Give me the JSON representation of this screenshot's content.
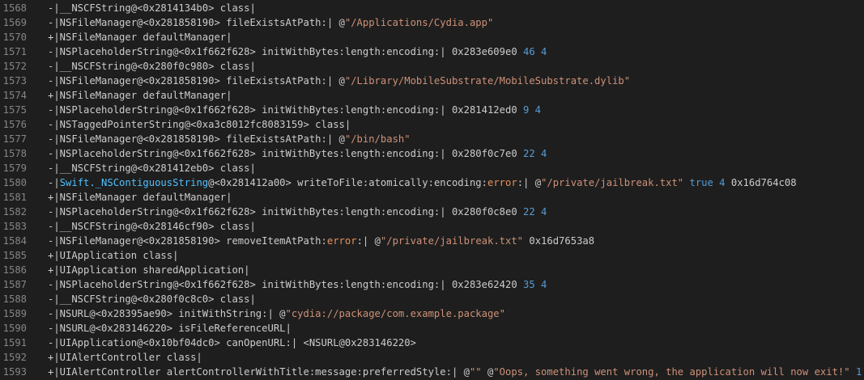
{
  "colors": {
    "background": "#1e1e1e",
    "line_number": "#858585",
    "text": "#cccccc",
    "string": "#ce9178",
    "number": "#569cd6",
    "keyword": "#4fc1ff",
    "error_keyword": "#e8925b"
  },
  "lines": [
    {
      "num": "1568",
      "tokens": [
        {
          "t": "-|__NSCFString@<0x2814134b0> class|",
          "k": "plain"
        }
      ]
    },
    {
      "num": "1569",
      "tokens": [
        {
          "t": "-|NSFileManager@<0x281858190> fileExistsAtPath:| @",
          "k": "plain"
        },
        {
          "t": "\"/Applications/Cydia.app\"",
          "k": "str"
        }
      ]
    },
    {
      "num": "1570",
      "tokens": [
        {
          "t": "+|NSFileManager defaultManager|",
          "k": "plain"
        }
      ]
    },
    {
      "num": "1571",
      "tokens": [
        {
          "t": "-|NSPlaceholderString@<0x1f662f628> initWithBytes:length:encoding:| 0x283e609e0 ",
          "k": "plain"
        },
        {
          "t": "46 4",
          "k": "num"
        }
      ]
    },
    {
      "num": "1572",
      "tokens": [
        {
          "t": "-|__NSCFString@<0x280f0c980> class|",
          "k": "plain"
        }
      ]
    },
    {
      "num": "1573",
      "tokens": [
        {
          "t": "-|NSFileManager@<0x281858190> fileExistsAtPath:| @",
          "k": "plain"
        },
        {
          "t": "\"/Library/MobileSubstrate/MobileSubstrate.dylib\"",
          "k": "str"
        }
      ]
    },
    {
      "num": "1574",
      "tokens": [
        {
          "t": "+|NSFileManager defaultManager|",
          "k": "plain"
        }
      ]
    },
    {
      "num": "1575",
      "tokens": [
        {
          "t": "-|NSPlaceholderString@<0x1f662f628> initWithBytes:length:encoding:| 0x281412ed0 ",
          "k": "plain"
        },
        {
          "t": "9 4",
          "k": "num"
        }
      ]
    },
    {
      "num": "1576",
      "tokens": [
        {
          "t": "-|NSTaggedPointerString@<0xa3c8012fc8083159> class|",
          "k": "plain"
        }
      ]
    },
    {
      "num": "1577",
      "tokens": [
        {
          "t": "-|NSFileManager@<0x281858190> fileExistsAtPath:| @",
          "k": "plain"
        },
        {
          "t": "\"/bin/bash\"",
          "k": "str"
        }
      ]
    },
    {
      "num": "1578",
      "tokens": [
        {
          "t": "-|NSPlaceholderString@<0x1f662f628> initWithBytes:length:encoding:| 0x280f0c7e0 ",
          "k": "plain"
        },
        {
          "t": "22 4",
          "k": "num"
        }
      ]
    },
    {
      "num": "1579",
      "tokens": [
        {
          "t": "-|__NSCFString@<0x281412eb0> class|",
          "k": "plain"
        }
      ]
    },
    {
      "num": "1580",
      "tokens": [
        {
          "t": "-|",
          "k": "plain"
        },
        {
          "t": "Swift._NSContiguousString",
          "k": "kw"
        },
        {
          "t": "@<0x281412a00> writeToFile:atomically:encoding:",
          "k": "plain"
        },
        {
          "t": "error",
          "k": "err"
        },
        {
          "t": ":| @",
          "k": "plain"
        },
        {
          "t": "\"/private/jailbreak.txt\"",
          "k": "str"
        },
        {
          "t": " ",
          "k": "plain"
        },
        {
          "t": "true 4",
          "k": "num"
        },
        {
          "t": " 0x16d764c08",
          "k": "plain"
        }
      ]
    },
    {
      "num": "1581",
      "tokens": [
        {
          "t": "+|NSFileManager defaultManager|",
          "k": "plain"
        }
      ]
    },
    {
      "num": "1582",
      "tokens": [
        {
          "t": "-|NSPlaceholderString@<0x1f662f628> initWithBytes:length:encoding:| 0x280f0c8e0 ",
          "k": "plain"
        },
        {
          "t": "22 4",
          "k": "num"
        }
      ]
    },
    {
      "num": "1583",
      "tokens": [
        {
          "t": "-|__NSCFString@<0x28146cf90> class|",
          "k": "plain"
        }
      ]
    },
    {
      "num": "1584",
      "tokens": [
        {
          "t": "-|NSFileManager@<0x281858190> removeItemAtPath:",
          "k": "plain"
        },
        {
          "t": "error",
          "k": "err"
        },
        {
          "t": ":| @",
          "k": "plain"
        },
        {
          "t": "\"/private/jailbreak.txt\"",
          "k": "str"
        },
        {
          "t": " 0x16d7653a8",
          "k": "plain"
        }
      ]
    },
    {
      "num": "1585",
      "tokens": [
        {
          "t": "+|UIApplication class|",
          "k": "plain"
        }
      ]
    },
    {
      "num": "1586",
      "tokens": [
        {
          "t": "+|UIApplication sharedApplication|",
          "k": "plain"
        }
      ]
    },
    {
      "num": "1587",
      "tokens": [
        {
          "t": "-|NSPlaceholderString@<0x1f662f628> initWithBytes:length:encoding:| 0x283e62420 ",
          "k": "plain"
        },
        {
          "t": "35 4",
          "k": "num"
        }
      ]
    },
    {
      "num": "1588",
      "tokens": [
        {
          "t": "-|__NSCFString@<0x280f0c8c0> class|",
          "k": "plain"
        }
      ]
    },
    {
      "num": "1589",
      "tokens": [
        {
          "t": "-|NSURL@<0x28395ae90> initWithString:| @",
          "k": "plain"
        },
        {
          "t": "\"cydia://package/com.example.package\"",
          "k": "str"
        }
      ]
    },
    {
      "num": "1590",
      "tokens": [
        {
          "t": "-|NSURL@<0x283146220> isFileReferenceURL|",
          "k": "plain"
        }
      ]
    },
    {
      "num": "1591",
      "tokens": [
        {
          "t": "-|UIApplication@<0x10bf04dc0> canOpenURL:| <NSURL@0x283146220>",
          "k": "plain"
        }
      ]
    },
    {
      "num": "1592",
      "tokens": [
        {
          "t": "+|UIAlertController class|",
          "k": "plain"
        }
      ]
    },
    {
      "num": "1593",
      "tokens": [
        {
          "t": "+|UIAlertController alertControllerWithTitle:message:preferredStyle:| @",
          "k": "plain"
        },
        {
          "t": "\"\"",
          "k": "str"
        },
        {
          "t": " @",
          "k": "plain"
        },
        {
          "t": "\"Oops, something went wrong, the application will now exit!\"",
          "k": "str"
        },
        {
          "t": " ",
          "k": "plain"
        },
        {
          "t": "1",
          "k": "num"
        }
      ]
    }
  ]
}
